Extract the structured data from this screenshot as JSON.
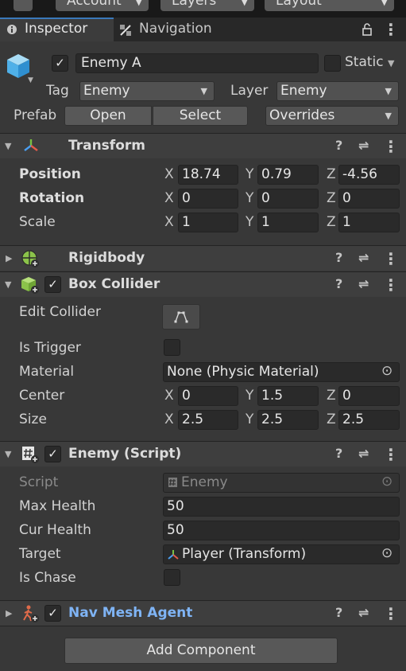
{
  "toolbar": {
    "account_label": "Account",
    "layers_label": "Layers",
    "layout_label": "Layout"
  },
  "tabs": {
    "inspector_label": "Inspector",
    "navigation_label": "Navigation"
  },
  "object": {
    "name": "Enemy A",
    "active_check": "✓",
    "static_label": "Static",
    "tag_label": "Tag",
    "tag_value": "Enemy",
    "layer_label": "Layer",
    "layer_value": "Enemy",
    "prefab_label": "Prefab",
    "open_label": "Open",
    "select_label": "Select",
    "overrides_label": "Overrides"
  },
  "transform": {
    "title": "Transform",
    "rows": [
      {
        "label": "Position",
        "x": "18.74",
        "y": "0.79",
        "z": "-4.56"
      },
      {
        "label": "Rotation",
        "x": "0",
        "y": "0",
        "z": "0"
      },
      {
        "label": "Scale",
        "x": "1",
        "y": "1",
        "z": "1"
      }
    ]
  },
  "axes": {
    "x": "X",
    "y": "Y",
    "z": "Z"
  },
  "rigidbody": {
    "title": "Rigidbody"
  },
  "box_collider": {
    "title": "Box Collider",
    "enabled_check": "✓",
    "edit_collider_label": "Edit Collider",
    "is_trigger_label": "Is Trigger",
    "material_label": "Material",
    "material_value": "None (Physic Material)",
    "center_label": "Center",
    "center": {
      "x": "0",
      "y": "1.5",
      "z": "0"
    },
    "size_label": "Size",
    "size": {
      "x": "2.5",
      "y": "2.5",
      "z": "2.5"
    }
  },
  "enemy_script": {
    "title": "Enemy (Script)",
    "enabled_check": "✓",
    "script_label": "Script",
    "script_value": "Enemy",
    "max_health_label": "Max Health",
    "max_health_value": "50",
    "cur_health_label": "Cur Health",
    "cur_health_value": "50",
    "target_label": "Target",
    "target_value": "Player (Transform)",
    "is_chase_label": "Is Chase"
  },
  "nav_mesh_agent": {
    "title": "Nav Mesh Agent",
    "enabled_check": "✓",
    "title_color": "#7fb4f5"
  },
  "add_component_label": "Add Component",
  "icons": {
    "help": "?",
    "preset": "⇌",
    "more": "⋮",
    "foldout_open": "▼",
    "foldout_closed": "▶",
    "dropdown": "▼",
    "object_picker": "⊙",
    "lock": "🔒"
  }
}
